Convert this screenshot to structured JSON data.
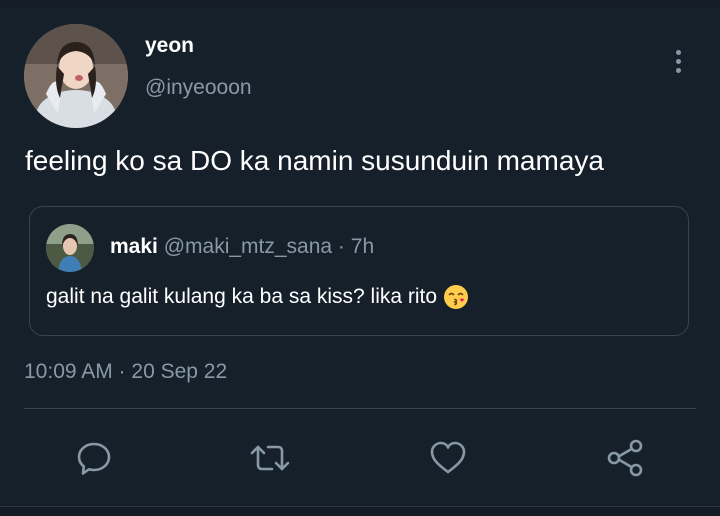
{
  "tweet": {
    "author_name": "yeon",
    "author_handle": "@inyeooon",
    "text": "feeling ko sa DO ka namin susunduin mamaya",
    "timestamp": "10:09 AM · 20 Sep 22"
  },
  "quoted_tweet": {
    "author_name": "maki",
    "meta": "@maki_mtz_sana · 7h",
    "text": "galit na galit kulang ka ba sa kiss? lika rito"
  },
  "actions": [
    "reply-icon",
    "retweet-icon",
    "like-icon",
    "share-icon"
  ],
  "colors": {
    "background": "#15202b",
    "secondary_text": "#8899a6",
    "border": "#38444d"
  }
}
